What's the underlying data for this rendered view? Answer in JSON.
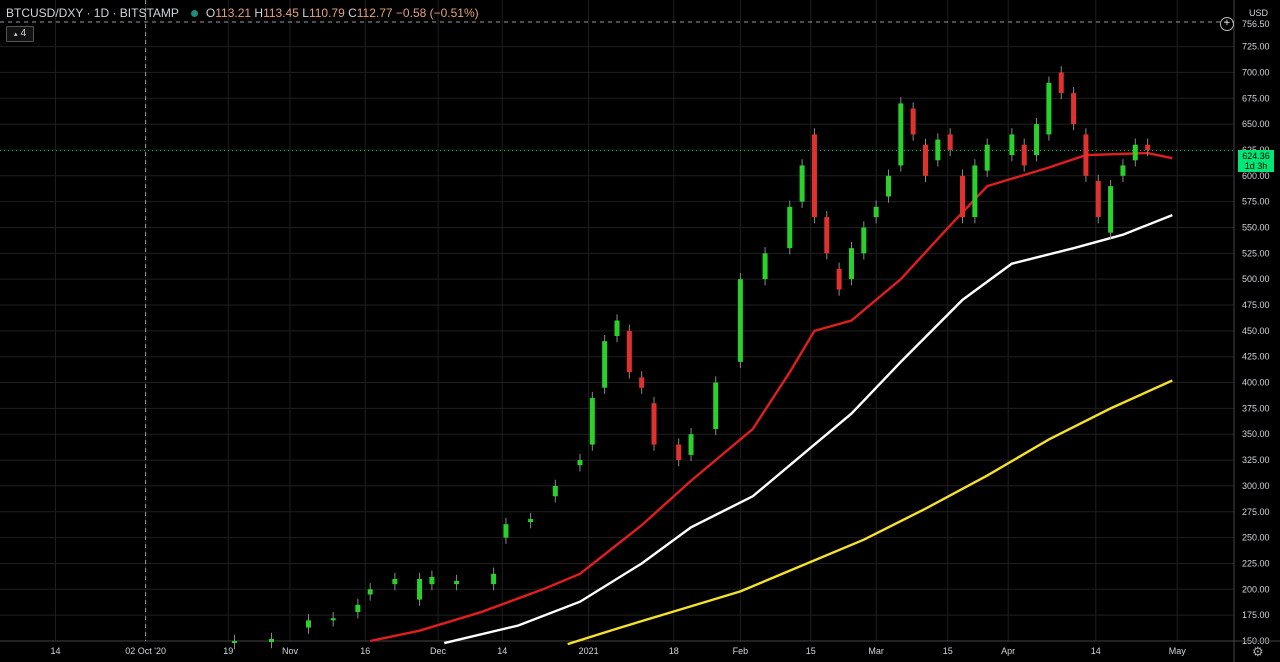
{
  "header": {
    "symbol": "BTCUSD/DXY · 1D · BITSTAMP",
    "ohlc_o": "O",
    "ohlc_o_val": "113.21",
    "ohlc_h": "H",
    "ohlc_h_val": "113.45",
    "ohlc_l": "L",
    "ohlc_l_val": "110.79",
    "ohlc_c": "C",
    "ohlc_c_val": "112.77",
    "ohlc_chg": "−0.58 (−0.51%)",
    "indicator_count": "4"
  },
  "price_axis": {
    "currency": "USD",
    "top_label": "756.50",
    "current_price": "624.36",
    "countdown": "1d 3h"
  },
  "colors": {
    "up": "#2bd12b",
    "down": "#e0312f",
    "wick": "#8a8a8a",
    "ma_fast": "#e01e1e",
    "ma_mid": "#ffffff",
    "ma_slow": "#f5e02a",
    "current_price_bg": "#00e676",
    "grid": "#1f1f1f"
  },
  "icons": {
    "plus": "plus-circle-icon",
    "settings": "gear-icon",
    "collapse": "chevron-up-icon"
  },
  "chart_data": {
    "type": "candlestick",
    "title": "BTCUSD/DXY · 1D · BITSTAMP",
    "ylim": [
      150,
      756.5
    ],
    "y_ticks": [
      150,
      175,
      200,
      225,
      250,
      275,
      300,
      325,
      350,
      375,
      400,
      425,
      450,
      475,
      500,
      525,
      550,
      575,
      600,
      625,
      650,
      675,
      700,
      725
    ],
    "x_ticks": [
      "14",
      "02 Oct '20",
      "19",
      "Nov",
      "16",
      "Dec",
      "14",
      "2021",
      "18",
      "Feb",
      "15",
      "Mar",
      "15",
      "Apr",
      "14",
      "May"
    ],
    "grid": true,
    "series": [
      {
        "name": "",
        "color": "#e01e1e",
        "points": [
          [
            0.3,
            150
          ],
          [
            0.34,
            160
          ],
          [
            0.39,
            178
          ],
          [
            0.44,
            200
          ],
          [
            0.47,
            215
          ],
          [
            0.52,
            262
          ],
          [
            0.56,
            305
          ],
          [
            0.61,
            355
          ],
          [
            0.64,
            410
          ],
          [
            0.66,
            450
          ],
          [
            0.69,
            460
          ],
          [
            0.73,
            500
          ],
          [
            0.77,
            552
          ],
          [
            0.8,
            590
          ],
          [
            0.85,
            608
          ],
          [
            0.88,
            620
          ],
          [
            0.93,
            622
          ],
          [
            0.95,
            617
          ]
        ]
      },
      {
        "name": "",
        "color": "#ffffff",
        "points": [
          [
            0.36,
            148
          ],
          [
            0.42,
            165
          ],
          [
            0.47,
            188
          ],
          [
            0.52,
            225
          ],
          [
            0.56,
            260
          ],
          [
            0.61,
            290
          ],
          [
            0.66,
            340
          ],
          [
            0.69,
            370
          ],
          [
            0.73,
            420
          ],
          [
            0.78,
            480
          ],
          [
            0.82,
            515
          ],
          [
            0.87,
            530
          ],
          [
            0.91,
            543
          ],
          [
            0.95,
            562
          ]
        ]
      },
      {
        "name": "",
        "color": "#f5e02a",
        "points": [
          [
            0.46,
            147
          ],
          [
            0.5,
            162
          ],
          [
            0.55,
            180
          ],
          [
            0.6,
            198
          ],
          [
            0.65,
            223
          ],
          [
            0.7,
            248
          ],
          [
            0.75,
            278
          ],
          [
            0.8,
            310
          ],
          [
            0.85,
            345
          ],
          [
            0.9,
            375
          ],
          [
            0.95,
            402
          ]
        ]
      }
    ],
    "candles_approx": [
      [
        0.19,
        148,
        150
      ],
      [
        0.22,
        149,
        152
      ],
      [
        0.25,
        163,
        170
      ],
      [
        0.27,
        170,
        172
      ],
      [
        0.29,
        178,
        185
      ],
      [
        0.3,
        195,
        200
      ],
      [
        0.32,
        205,
        210
      ],
      [
        0.34,
        190,
        210
      ],
      [
        0.35,
        205,
        212
      ],
      [
        0.37,
        205,
        208
      ],
      [
        0.4,
        205,
        215
      ],
      [
        0.41,
        250,
        263
      ],
      [
        0.43,
        265,
        268
      ],
      [
        0.45,
        290,
        300
      ],
      [
        0.47,
        320,
        325
      ],
      [
        0.48,
        340,
        385
      ],
      [
        0.49,
        395,
        440
      ],
      [
        0.5,
        445,
        460
      ],
      [
        0.51,
        450,
        410
      ],
      [
        0.52,
        405,
        395
      ],
      [
        0.53,
        380,
        340
      ],
      [
        0.55,
        340,
        325
      ],
      [
        0.56,
        330,
        350
      ],
      [
        0.58,
        355,
        400
      ],
      [
        0.6,
        420,
        500
      ],
      [
        0.62,
        500,
        525
      ],
      [
        0.64,
        530,
        570
      ],
      [
        0.65,
        575,
        610
      ],
      [
        0.66,
        640,
        560
      ],
      [
        0.67,
        560,
        525
      ],
      [
        0.68,
        510,
        490
      ],
      [
        0.69,
        500,
        530
      ],
      [
        0.7,
        525,
        550
      ],
      [
        0.71,
        560,
        570
      ],
      [
        0.72,
        580,
        600
      ],
      [
        0.73,
        610,
        670
      ],
      [
        0.74,
        665,
        640
      ],
      [
        0.75,
        630,
        600
      ],
      [
        0.76,
        615,
        635
      ],
      [
        0.77,
        640,
        625
      ],
      [
        0.78,
        600,
        560
      ],
      [
        0.79,
        560,
        610
      ],
      [
        0.8,
        605,
        630
      ],
      [
        0.82,
        620,
        640
      ],
      [
        0.83,
        630,
        610
      ],
      [
        0.84,
        620,
        650
      ],
      [
        0.85,
        640,
        690
      ],
      [
        0.86,
        700,
        680
      ],
      [
        0.87,
        680,
        650
      ],
      [
        0.88,
        640,
        600
      ],
      [
        0.89,
        595,
        560
      ],
      [
        0.9,
        545,
        590
      ],
      [
        0.91,
        600,
        610
      ],
      [
        0.92,
        615,
        630
      ],
      [
        0.93,
        630,
        625
      ]
    ]
  }
}
